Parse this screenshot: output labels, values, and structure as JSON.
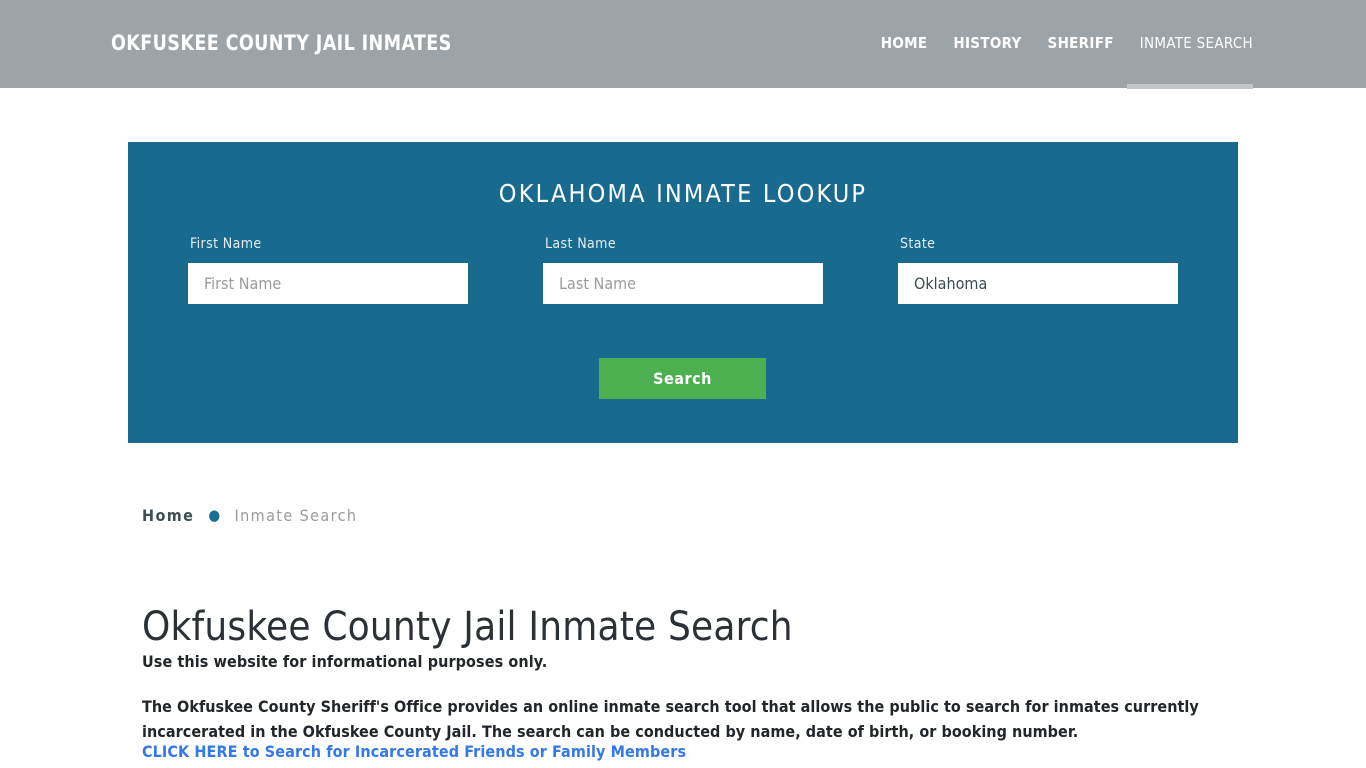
{
  "header": {
    "brand": "OKFUSKEE COUNTY JAIL INMATES",
    "brand_color": "#ffffff",
    "background_color": "#9ea3a7",
    "nav": [
      {
        "label": "HOME",
        "active": false
      },
      {
        "label": "HISTORY",
        "active": false
      },
      {
        "label": "SHERIFF",
        "active": false
      },
      {
        "label": "INMATE SEARCH",
        "active": true
      }
    ]
  },
  "lookup": {
    "title": "OKLAHOMA INMATE LOOKUP",
    "panel_color": "#186a8e",
    "fields": {
      "first_name": {
        "label": "First Name",
        "placeholder": "First Name",
        "value": ""
      },
      "last_name": {
        "label": "Last Name",
        "placeholder": "Last Name",
        "value": ""
      },
      "state": {
        "label": "State",
        "placeholder": "State",
        "value": "Oklahoma"
      }
    },
    "search_button": {
      "label": "Search",
      "color": "#4cb050"
    }
  },
  "breadcrumb": {
    "home": "Home",
    "separator": "●",
    "current": "Inmate Search",
    "separator_color": "#1a6e91"
  },
  "content": {
    "title": "Okfuskee County Jail Inmate Search",
    "lede": "Use this website for informational purposes only.",
    "paragraph": "The Okfuskee County Sheriff's Office provides an online inmate search tool that allows the public to search for inmates currently incarcerated in the Okfuskee County Jail. The search can be conducted by name, date of birth, or booking number.",
    "cta_link": "CLICK HERE to Search for Incarcerated Friends or Family Members",
    "cta_link_color": "#3579e6"
  }
}
